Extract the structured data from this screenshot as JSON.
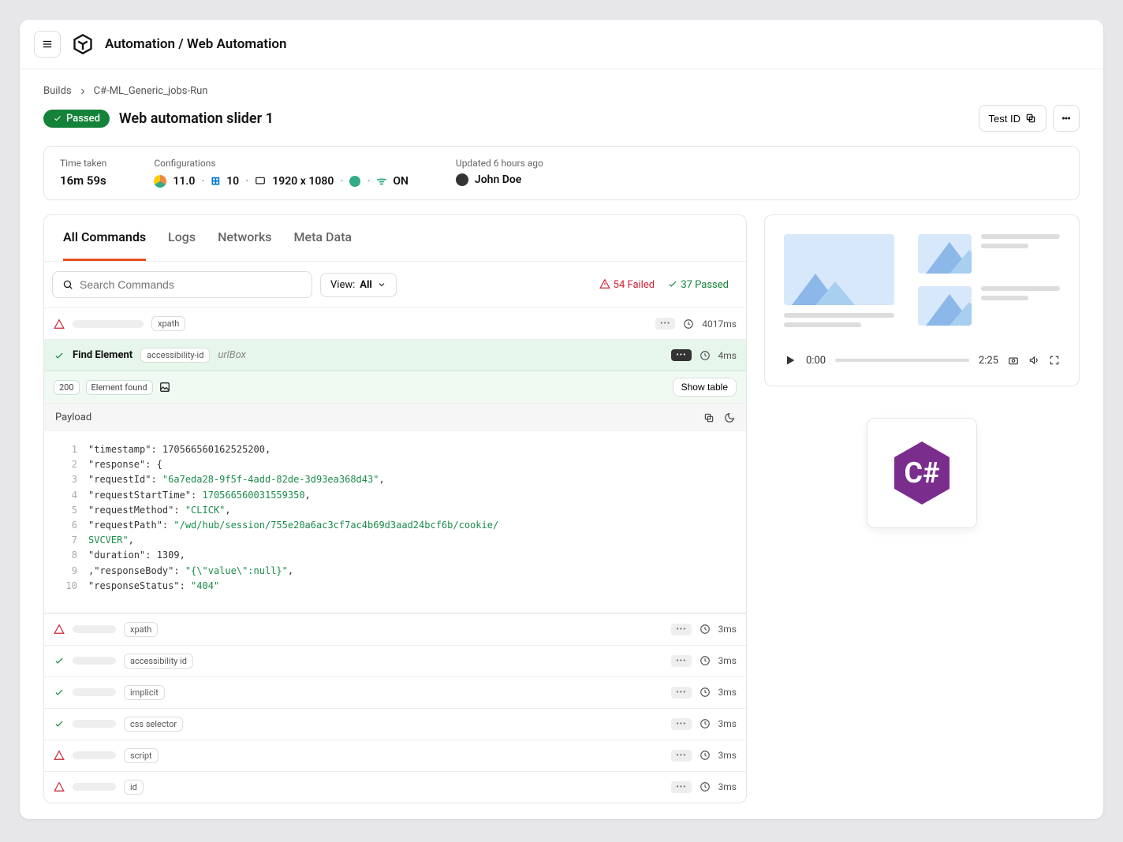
{
  "header": {
    "title": "Automation / Web Automation"
  },
  "crumbs": {
    "root": "Builds",
    "current": "C#-ML_Generic_jobs-Run"
  },
  "status": {
    "badge": "Passed",
    "title": "Web automation slider 1",
    "test_id_btn": "Test ID"
  },
  "info": {
    "time_label": "Time taken",
    "time_val": "16m 59s",
    "config_label": "Configurations",
    "browser_ver": "11.0",
    "os_ver": "10",
    "resolution": "1920 x 1080",
    "proxy": "ON",
    "updated_label": "Updated 6 hours ago",
    "user": "John Doe"
  },
  "tabs": {
    "t1": "All Commands",
    "t2": "Logs",
    "t3": "Networks",
    "t4": "Meta Data"
  },
  "search": {
    "placeholder": "Search Commands",
    "view_label": "View:",
    "view_val": "All"
  },
  "counts": {
    "failed": "54 Failed",
    "passed": "37 Passed"
  },
  "row0": {
    "tag": "xpath",
    "time": "4017ms"
  },
  "row_find": {
    "name": "Find Element",
    "tag": "accessibility-id",
    "extra": "urlBox",
    "time": "4ms"
  },
  "status_row": {
    "code": "200",
    "msg": "Element found",
    "btn": "Show table"
  },
  "payload": {
    "title": "Payload",
    "code": {
      "l1": "\"timestamp\": 170566560162525200,",
      "l2": "    \"response\": {",
      "l3a": "    \"requestId\": ",
      "l3b": "\"6a7eda28-9f5f-4add-82de-3d93ea368d43\"",
      "l3c": ",",
      "l4a": "    \"requestStartTime\": ",
      "l4b": "170566560031559350",
      "l4c": ",",
      "l5a": "    \"requestMethod\": ",
      "l5b": "\"CLICK\"",
      "l5c": ",",
      "l6a": "    \"requestPath\": ",
      "l6b": "\"/wd/hub/session/755e20a6ac3cf7ac4b69d3aad24bcf6b/cookie/",
      "l7a": "                   ",
      "l7b": "SVCVER\"",
      "l7c": ",",
      "l8": "    \"duration\": 1309,",
      "l9a": "    ,\"responseBody\": ",
      "l9b": "\"{\\\"value\\\":null}\"",
      "l9c": ",",
      "l10a": "    \"responseStatus\": ",
      "l10b": "\"404\""
    }
  },
  "rows": [
    {
      "tag": "xpath",
      "time": "3ms",
      "status": "fail"
    },
    {
      "tag": "accessibility id",
      "time": "3ms",
      "status": "pass"
    },
    {
      "tag": "implicit",
      "time": "3ms",
      "status": "pass"
    },
    {
      "tag": "css selector",
      "time": "3ms",
      "status": "pass"
    },
    {
      "tag": "script",
      "time": "3ms",
      "status": "fail"
    },
    {
      "tag": "id",
      "time": "3ms",
      "status": "fail"
    }
  ],
  "player": {
    "start": "0:00",
    "end": "2:25"
  }
}
